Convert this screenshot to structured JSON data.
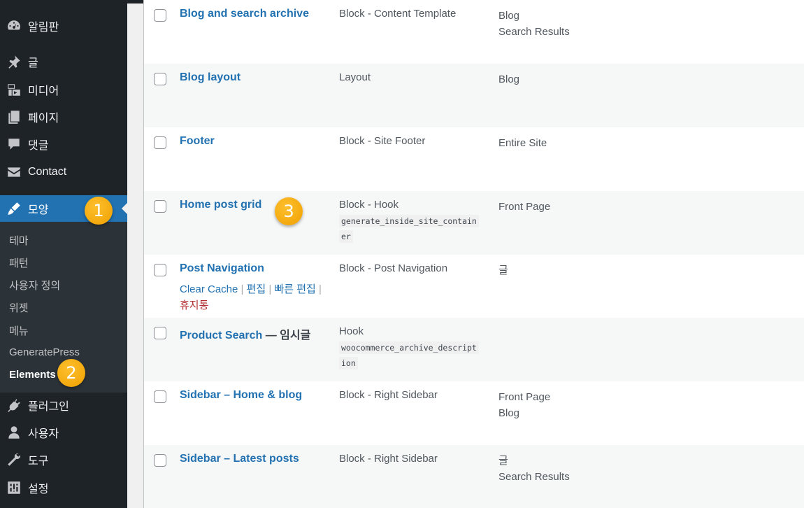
{
  "sidebar": {
    "menu": [
      {
        "label": "알림판",
        "icon": "dashboard-icon"
      },
      {
        "label": "글",
        "icon": "pin-icon"
      },
      {
        "label": "미디어",
        "icon": "media-icon"
      },
      {
        "label": "페이지",
        "icon": "pages-icon"
      },
      {
        "label": "댓글",
        "icon": "comments-icon"
      },
      {
        "label": "Contact",
        "icon": "mail-icon"
      },
      {
        "label": "모양",
        "icon": "appearance-icon"
      }
    ],
    "submenu": [
      "테마",
      "패턴",
      "사용자 정의",
      "위젯",
      "메뉴",
      "GeneratePress",
      "Elements"
    ],
    "menu_bottom": [
      {
        "label": "플러그인",
        "icon": "plugins-icon"
      },
      {
        "label": "사용자",
        "icon": "users-icon"
      },
      {
        "label": "도구",
        "icon": "tools-icon"
      },
      {
        "label": "설정",
        "icon": "settings-icon"
      }
    ]
  },
  "badges": [
    "1",
    "2",
    "3"
  ],
  "rows": [
    {
      "title": "Blog and search archive",
      "type": "Block - Content Template",
      "loc1": "Blog",
      "loc2": "Search Results"
    },
    {
      "title": "Blog layout",
      "type": "Layout",
      "loc1": "Blog"
    },
    {
      "title": "Footer",
      "type": "Block - Site Footer",
      "loc1": "Entire Site"
    },
    {
      "title": "Home post grid",
      "type": "Block - Hook",
      "hook1": "generate_inside_site_contain",
      "hook2": "er",
      "loc1": "Front Page"
    },
    {
      "title": "Post Navigation",
      "type": "Block - Post Navigation",
      "loc1": "글",
      "actions": {
        "clear_cache": "Clear Cache",
        "sep": "|",
        "edit": "편집",
        "quick_edit": "빠른 편집",
        "trash": "휴지통"
      }
    },
    {
      "title": "Product Search",
      "state": " — 임시글",
      "type": "Hook",
      "hook1": "woocommerce_archive_descript",
      "hook2": "ion"
    },
    {
      "title": "Sidebar – Home & blog",
      "type": "Block - Right Sidebar",
      "loc1": "Front Page",
      "loc2": "Blog"
    },
    {
      "title": "Sidebar – Latest posts",
      "type": "Block - Right Sidebar",
      "loc1": "글",
      "loc2": "Search Results"
    }
  ]
}
